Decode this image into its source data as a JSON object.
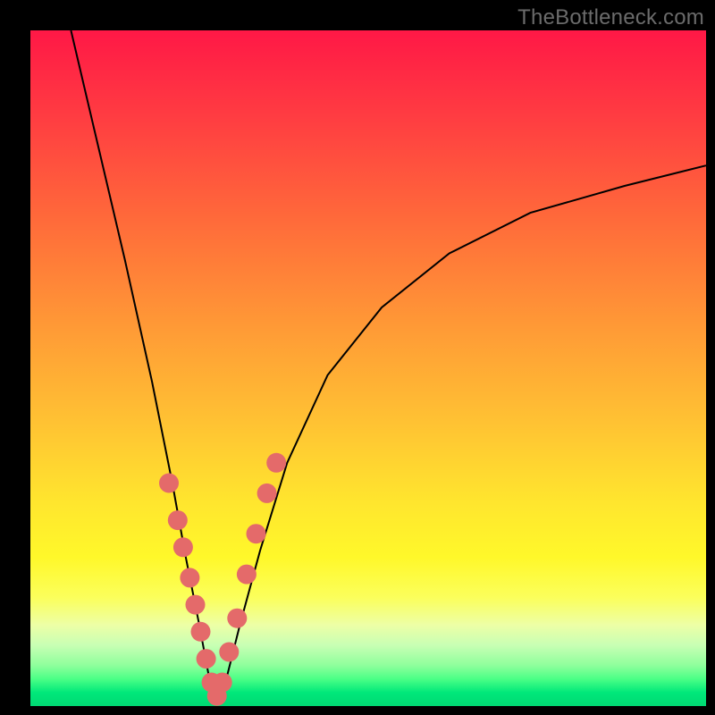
{
  "watermark": "TheBottleneck.com",
  "colors": {
    "frame": "#000000",
    "curve": "#000000",
    "dot": "#e46a6a"
  },
  "chart_data": {
    "type": "line",
    "title": "",
    "xlabel": "",
    "ylabel": "",
    "xlim": [
      0,
      100
    ],
    "ylim": [
      0,
      100
    ],
    "note": "Axes unlabeled in source; values are relative percentages estimated from pixel positions. Minimum of the V-curve sits near x≈27, y≈0. Left branch is steep; right branch rises more gradually.",
    "series": [
      {
        "name": "bottleneck-curve",
        "x": [
          6,
          10,
          14,
          18,
          21,
          23,
          25,
          26.5,
          27.5,
          29,
          31,
          34,
          38,
          44,
          52,
          62,
          74,
          88,
          100
        ],
        "y": [
          100,
          83,
          66,
          48,
          33,
          22,
          12,
          4,
          1,
          4,
          12,
          23,
          36,
          49,
          59,
          67,
          73,
          77,
          80
        ]
      }
    ],
    "points": {
      "name": "highlighted-samples",
      "note": "Salmon dots clustered around the bottom of the V.",
      "x": [
        20.5,
        21.8,
        22.6,
        23.6,
        24.4,
        25.2,
        26.0,
        26.8,
        27.6,
        28.4,
        29.4,
        30.6,
        32.0,
        33.4,
        35.0,
        36.4
      ],
      "y": [
        33.0,
        27.5,
        23.5,
        19.0,
        15.0,
        11.0,
        7.0,
        3.5,
        1.5,
        3.5,
        8.0,
        13.0,
        19.5,
        25.5,
        31.5,
        36.0
      ]
    }
  }
}
